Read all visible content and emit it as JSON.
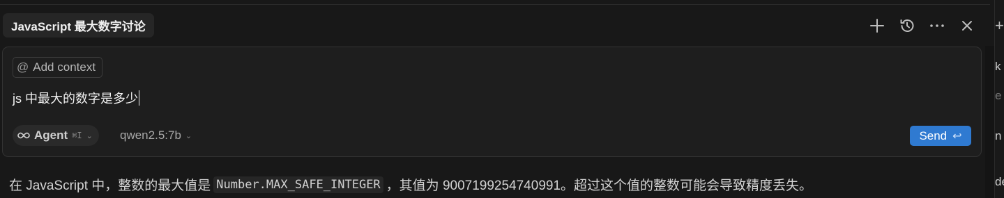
{
  "tab": {
    "title": "JavaScript 最大数字讨论"
  },
  "header_icons": [
    "plus-icon",
    "history-icon",
    "more-icon",
    "close-icon"
  ],
  "composer": {
    "add_context_label": "Add context",
    "prompt_text": "js 中最大的数字是多少",
    "agent_label": "Agent",
    "agent_shortcut": "⌘I",
    "model_label": "qwen2.5:7b",
    "send_label": "Send"
  },
  "answer": {
    "prefix": "在 JavaScript 中，整数的最大值是",
    "code": "Number.MAX_SAFE_INTEGER",
    "suffix": "，其值为 9007199254740991。超过这个值的整数可能会导致精度丢失。"
  },
  "right_edge": [
    "k",
    "e",
    "n",
    "de"
  ],
  "colors": {
    "accent": "#2f7ad1",
    "background": "#181818",
    "panel": "#1e1e1e"
  }
}
